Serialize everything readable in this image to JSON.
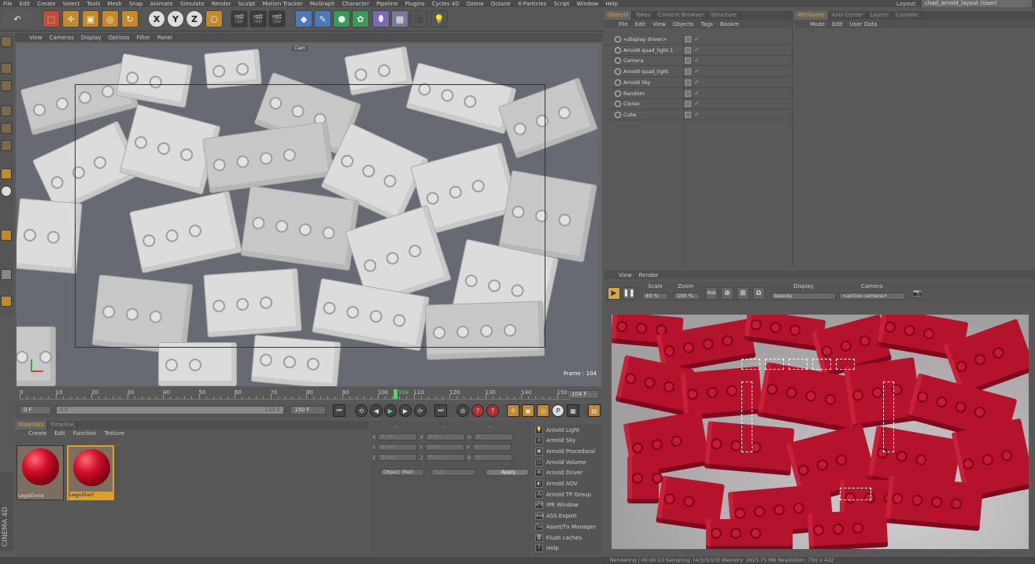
{
  "menubar": [
    "File",
    "Edit",
    "Create",
    "Select",
    "Tools",
    "Mesh",
    "Snap",
    "Animate",
    "Simulate",
    "Render",
    "Sculpt",
    "Motion Tracker",
    "MoGraph",
    "Character",
    "Pipeline",
    "Plugins",
    "Cycles 4D",
    "Ozone",
    "Octane",
    "X-Particles",
    "Script",
    "Window",
    "Help"
  ],
  "layout": {
    "label": "Layout:",
    "value": "chad_arnold_layout (User)"
  },
  "viewport": {
    "menu": [
      "View",
      "Cameras",
      "Display",
      "Options",
      "Filter",
      "Panel"
    ],
    "camera_tag": "Cam",
    "frame_label": "Frame : 104"
  },
  "timeline": {
    "ticks": [
      "0",
      "10",
      "20",
      "30",
      "40",
      "50",
      "60",
      "70",
      "80",
      "90",
      "100",
      "110",
      "120",
      "130",
      "140",
      "150"
    ],
    "current_marker": "104",
    "end_field": "104 F",
    "start_field": "0 F",
    "range_start": "0 F",
    "range_end": "150 F",
    "end_frame": "150 F"
  },
  "materials": {
    "tabs": [
      "Materials",
      "Timeline"
    ],
    "menu": [
      "Create",
      "Edit",
      "Function",
      "Texture"
    ],
    "items": [
      {
        "name": "LegoDone",
        "selected": false
      },
      {
        "name": "LegoStart",
        "selected": true
      }
    ]
  },
  "coordinates": {
    "rows": [
      {
        "a": "X",
        "av": "0 cm",
        "b": "X",
        "bv": "0 cm",
        "c": "H",
        "cv": "0 °"
      },
      {
        "a": "Y",
        "av": "0 cm",
        "b": "Y",
        "bv": "0 cm",
        "c": "P",
        "cv": "0 °"
      },
      {
        "a": "Z",
        "av": "0 cm",
        "b": "Z",
        "bv": "0 cm",
        "c": "B",
        "cv": "0 °"
      }
    ],
    "mode": "Object (Rel)",
    "size_mode": "Size",
    "apply": "Apply",
    "header_a": "--",
    "header_b": "--",
    "header_c": "--"
  },
  "arnold_menu": [
    {
      "label": "Arnold Light",
      "icon": "light-bulb-icon",
      "glyph": "💡"
    },
    {
      "label": "Arnold Sky",
      "icon": "sky-icon",
      "glyph": "◎"
    },
    {
      "label": "Arnold Procedural",
      "icon": "procedural-icon",
      "glyph": "▣"
    },
    {
      "label": "Arnold Volume",
      "icon": "volume-icon",
      "glyph": "▢"
    },
    {
      "label": "Arnold Driver",
      "icon": "driver-icon",
      "glyph": "⚙"
    },
    {
      "label": "Arnold AOV",
      "icon": "aov-icon",
      "glyph": "◐"
    },
    {
      "label": "Arnold TP Group",
      "icon": "tp-group-icon",
      "glyph": "⁂"
    },
    {
      "label": "IPR Window",
      "icon": "ipr-icon",
      "glyph": "IPR"
    },
    {
      "label": "ASS Export",
      "icon": "ass-export-icon",
      "glyph": "Ass"
    },
    {
      "label": "Asset/Tx Manager",
      "icon": "tx-manager-icon",
      "glyph": "Tx"
    },
    {
      "label": "Flush caches",
      "icon": "trash-icon",
      "glyph": "🗑"
    },
    {
      "label": "Help",
      "icon": "help-icon",
      "glyph": "?"
    }
  ],
  "objects_panel": {
    "tabs": [
      "Objects",
      "Takes",
      "Content Browser",
      "Structure"
    ],
    "menu": [
      "File",
      "Edit",
      "View",
      "Objects",
      "Tags",
      "Bookm"
    ],
    "rows": [
      {
        "name": "<display driver>",
        "icon": "document-icon",
        "check": "✓"
      },
      {
        "name": "Arnold quad_light.1",
        "icon": "light-bulb-icon",
        "check": "✓"
      },
      {
        "name": "Camera",
        "icon": "camera-icon",
        "check": "✓"
      },
      {
        "name": "Arnold quad_light",
        "icon": "light-bulb-icon",
        "check": "✓"
      },
      {
        "name": "Arnold Sky",
        "icon": "sky-icon",
        "check": "✓"
      },
      {
        "name": "Random",
        "icon": "random-icon",
        "check": "✓"
      },
      {
        "name": "Cloner",
        "icon": "cloner-icon",
        "check": "✓"
      },
      {
        "name": "Cube",
        "icon": "cube-icon",
        "check": "✓"
      }
    ]
  },
  "attributes_panel": {
    "tabs": [
      "Attributes",
      "Axis Center",
      "Layers",
      "Console"
    ],
    "menu": [
      "Mode",
      "Edit",
      "User Data"
    ]
  },
  "render_view": {
    "menu": [
      "View",
      "Render"
    ],
    "scale_label": "Scale",
    "scale_value": "40 %",
    "zoom_label": "Zoom",
    "zoom_value": "100 %",
    "rgb": "RGB",
    "display_label": "Display",
    "display_value": "beauty",
    "camera_label": "Camera",
    "camera_value": "<active camera>"
  },
  "status": "Rendering | 00:00:13  Sampling: [4/3/3/3/3]  Memory: 1615.75 MB  Resolution: 750 x 422",
  "colors": {
    "accent": "#d9a640",
    "brick_red": "#b5122b",
    "panel": "#595959"
  }
}
